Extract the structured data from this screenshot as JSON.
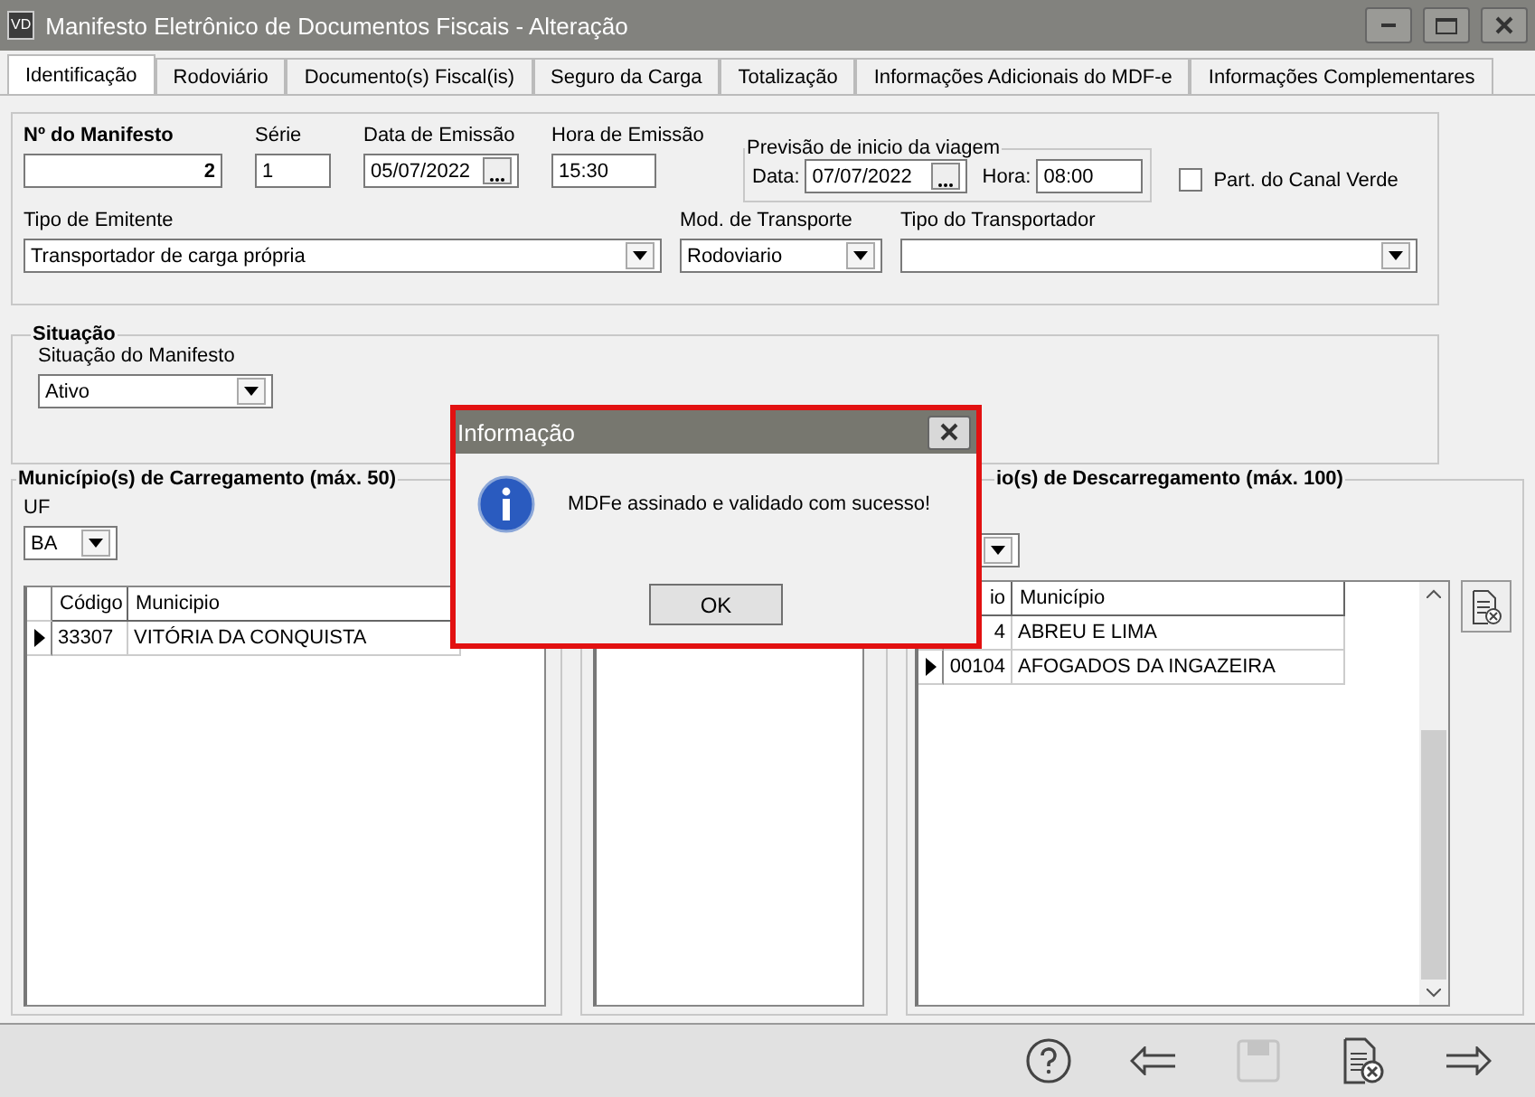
{
  "window": {
    "title": "Manifesto Eletrônico de Documentos Fiscais - Alteração",
    "logo": "VD"
  },
  "tabs": [
    {
      "label": "Identificação",
      "selected": true
    },
    {
      "label": "Rodoviário",
      "selected": false
    },
    {
      "label": "Documento(s) Fiscal(is)",
      "selected": false
    },
    {
      "label": "Seguro da Carga",
      "selected": false
    },
    {
      "label": "Totalização",
      "selected": false
    },
    {
      "label": "Informações Adicionais do MDF-e",
      "selected": false
    },
    {
      "label": "Informações Complementares",
      "selected": false
    }
  ],
  "manifest": {
    "numero_label": "Nº do Manifesto",
    "numero": "2",
    "serie_label": "Série",
    "serie": "1",
    "data_label": "Data de Emissão",
    "data": "05/07/2022",
    "hora_label": "Hora de Emissão",
    "hora": "15:30",
    "previsao": {
      "title": "Previsão de inicio da viagem",
      "data_label": "Data:",
      "data": "07/07/2022",
      "hora_label": "Hora:",
      "hora": "08:00"
    },
    "canal_verde": {
      "label": "Part. do Canal Verde",
      "checked": false
    },
    "tipo_emitente_label": "Tipo de Emitente",
    "tipo_emitente": "Transportador de carga própria",
    "mod_label": "Mod. de Transporte",
    "mod": "Rodoviario",
    "tipo_transportador_label": "Tipo do Transportador"
  },
  "situacao": {
    "title": "Situação",
    "label": "Situação do Manifesto",
    "value": "Ativo"
  },
  "carregamento": {
    "title": "Município(s) de Carregamento (máx. 50)",
    "uf_label": "UF",
    "uf": "BA",
    "columns": [
      "Código",
      "Municipio"
    ],
    "rows": [
      {
        "codigo": "33307",
        "municipio": "VITÓRIA DA CONQUISTA",
        "selected": true
      }
    ]
  },
  "descarregamento": {
    "title": "io(s) de Descarregamento (máx. 100)",
    "columns": [
      "io",
      "Município"
    ],
    "rows": [
      {
        "codigo": "4",
        "municipio": "ABREU E LIMA"
      },
      {
        "codigo": "00104",
        "municipio": "AFOGADOS DA INGAZEIRA",
        "selected": true
      }
    ]
  },
  "toolbar": [
    {
      "kind": "help",
      "disabled": false
    },
    {
      "kind": "back",
      "disabled": false
    },
    {
      "kind": "save",
      "disabled": true
    },
    {
      "kind": "cancel",
      "disabled": false
    },
    {
      "kind": "forward",
      "disabled": false
    }
  ],
  "dialog": {
    "title": "Informação",
    "message": "MDFe assinado e validado com sucesso!",
    "button": "OK"
  }
}
